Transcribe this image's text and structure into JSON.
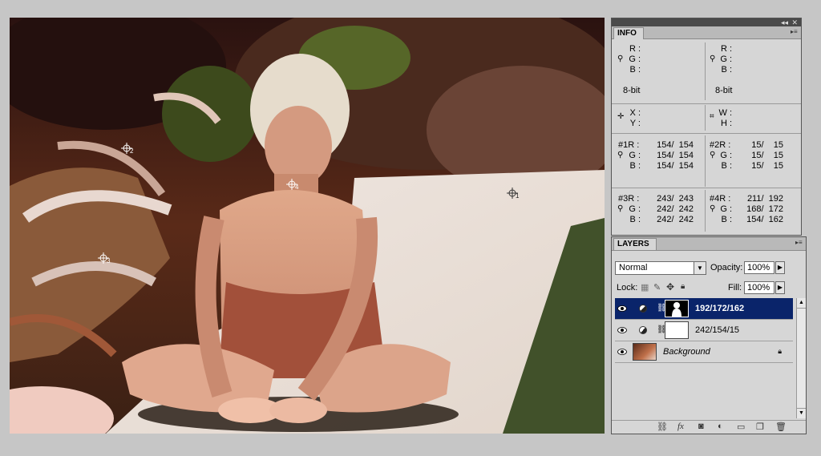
{
  "samplers": [
    {
      "id": "sampler-1",
      "number": "1"
    },
    {
      "id": "sampler-2",
      "number": "2"
    },
    {
      "id": "sampler-3",
      "number": "3"
    },
    {
      "id": "sampler-4",
      "number": "4"
    }
  ],
  "info": {
    "tab": "INFO",
    "left_rgb": {
      "r": "R :",
      "g": "G :",
      "b": "B :",
      "depth": "8-bit"
    },
    "right_rgb": {
      "r": "R :",
      "g": "G :",
      "b": "B :",
      "depth": "8-bit"
    },
    "xy": {
      "x": "X :",
      "y": "Y :"
    },
    "wh": {
      "w": "W :",
      "h": "H :"
    },
    "s1": {
      "r_label": "#1R :",
      "g_label": "G :",
      "b_label": "B :",
      "r": "154/  154",
      "g": "154/  154",
      "b": "154/  154"
    },
    "s2": {
      "r_label": "#2R :",
      "g_label": "G :",
      "b_label": "B :",
      "r": "15/    15",
      "g": "15/    15",
      "b": "15/    15"
    },
    "s3": {
      "r_label": "#3R :",
      "g_label": "G :",
      "b_label": "B :",
      "r": "243/  243",
      "g": "242/  242",
      "b": "242/  242"
    },
    "s4": {
      "r_label": "#4R :",
      "g_label": "G :",
      "b_label": "B :",
      "r": "211/  192",
      "g": "168/  172",
      "b": "154/  162"
    }
  },
  "layers": {
    "tab": "LAYERS",
    "blend_mode": "Normal",
    "opacity_label": "Opacity:",
    "opacity": "100%",
    "lock_label": "Lock:",
    "fill_label": "Fill:",
    "fill": "100%",
    "items": [
      {
        "name": "192/172/162",
        "selected": true
      },
      {
        "name": "242/154/15",
        "selected": false
      },
      {
        "name": "Background",
        "selected": false
      }
    ]
  },
  "colors": {
    "selection": "#0a246a",
    "panel_bg": "#d6d6d6",
    "workspace": "#c6c6c6"
  }
}
